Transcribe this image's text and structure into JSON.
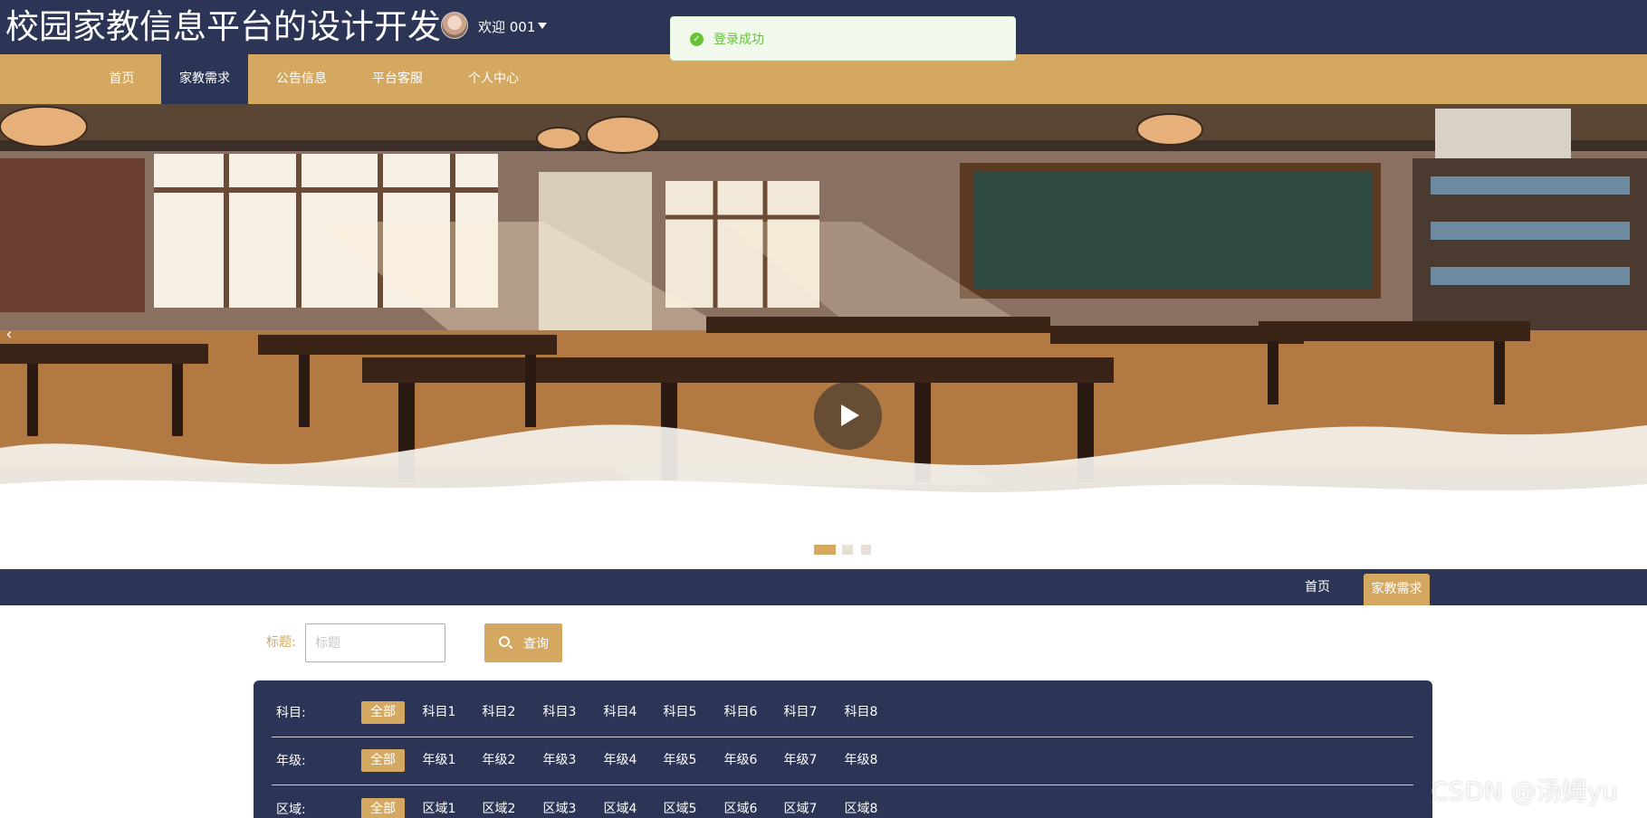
{
  "header": {
    "site_title": "校园家教信息平台的设计开发",
    "welcome": "欢迎 001"
  },
  "toast": {
    "message": "登录成功"
  },
  "nav": {
    "items": [
      {
        "label": "首页"
      },
      {
        "label": "家教需求"
      },
      {
        "label": "公告信息"
      },
      {
        "label": "平台客服"
      },
      {
        "label": "个人中心"
      }
    ],
    "active": "家教需求"
  },
  "banner": {
    "prev_arrow": "‹",
    "slide_count": 3,
    "active_slide": 1
  },
  "breadcrumb": {
    "home": "首页",
    "current": "家教需求"
  },
  "search": {
    "label": "标题:",
    "placeholder": "标题",
    "value": "",
    "button": "查询"
  },
  "filters": [
    {
      "label": "科目:",
      "options": [
        "全部",
        "科目1",
        "科目2",
        "科目3",
        "科目4",
        "科目5",
        "科目6",
        "科目7",
        "科目8"
      ],
      "selected": "全部"
    },
    {
      "label": "年级:",
      "options": [
        "全部",
        "年级1",
        "年级2",
        "年级3",
        "年级4",
        "年级5",
        "年级6",
        "年级7",
        "年级8"
      ],
      "selected": "全部"
    },
    {
      "label": "区域:",
      "options": [
        "全部",
        "区域1",
        "区域2",
        "区域3",
        "区域4",
        "区域5",
        "区域6",
        "区域7",
        "区域8"
      ],
      "selected": "全部"
    }
  ],
  "watermark": "CSDN @汤姆yu",
  "colors": {
    "primary_navy": "#2d3557",
    "accent_gold": "#d4a860",
    "success_green": "#67c23a"
  }
}
